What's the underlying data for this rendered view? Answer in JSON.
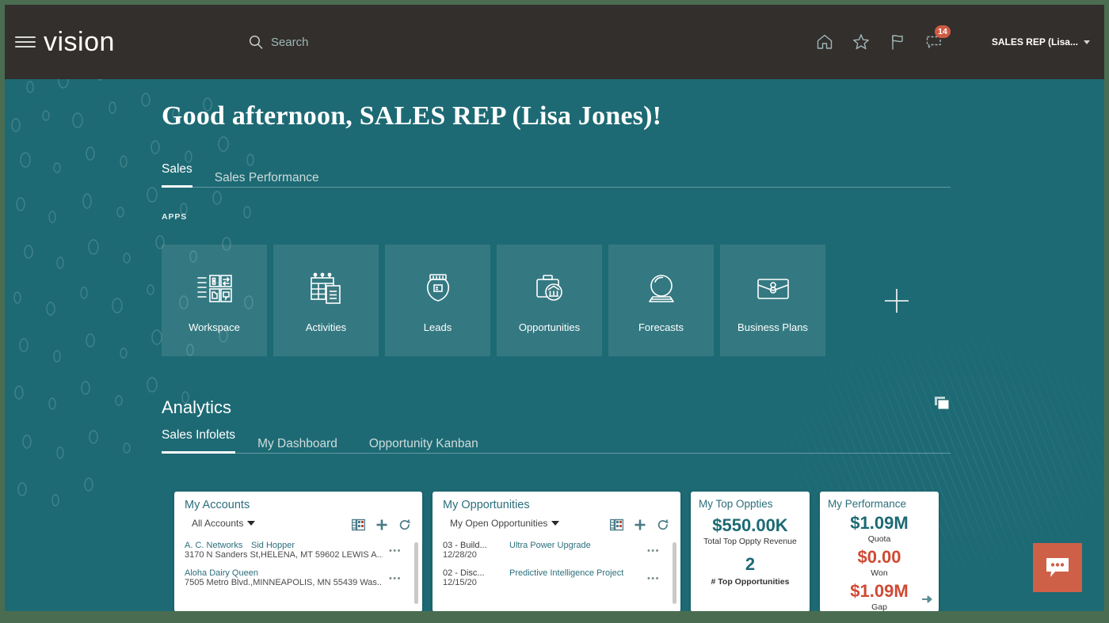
{
  "colors": {
    "outer_frame": "#4a6d51",
    "page_background": "#1d6a74",
    "topbar": "#332f2c",
    "accent_orange": "#cf6048",
    "badge_red": "#cf5b44",
    "card_title_teal": "#2b6e7b",
    "kpi_red": "#cf4a33"
  },
  "topbar": {
    "menu_icon": "hamburger-icon",
    "brand": "vision",
    "search": {
      "icon": "search-icon",
      "label": "Search",
      "placeholder": "Search"
    },
    "icons": [
      {
        "name": "home-icon",
        "label": "Home"
      },
      {
        "name": "star-icon",
        "label": "Favorites"
      },
      {
        "name": "flag-icon",
        "label": "Flags"
      },
      {
        "name": "notifications-icon",
        "label": "Notifications",
        "badge": "14"
      }
    ],
    "user": {
      "label": "SALES REP (Lisa...",
      "caret": "chevron-down-icon"
    }
  },
  "main": {
    "greeting": "Good afternoon, SALES REP (Lisa Jones)!",
    "tabs": [
      {
        "label": "Sales",
        "active": true
      },
      {
        "label": "Sales Performance",
        "active": false
      }
    ],
    "apps_label": "APPS",
    "apps": [
      {
        "label": "Workspace",
        "icon": "workspace-icon"
      },
      {
        "label": "Activities",
        "icon": "calendar-icon"
      },
      {
        "label": "Leads",
        "icon": "leads-icon"
      },
      {
        "label": "Opportunities",
        "icon": "briefcase-icon"
      },
      {
        "label": "Forecasts",
        "icon": "crystal-ball-icon"
      },
      {
        "label": "Business Plans",
        "icon": "portfolio-icon"
      }
    ],
    "add_app": {
      "icon": "plus-icon",
      "label": "Add App"
    }
  },
  "analytics": {
    "title": "Analytics",
    "expand_icon": "stacked-cards-icon",
    "tabs": [
      {
        "label": "Sales Infolets",
        "active": true
      },
      {
        "label": "My Dashboard",
        "active": false
      },
      {
        "label": "Opportunity Kanban",
        "active": false
      }
    ]
  },
  "cards": {
    "my_accounts": {
      "title": "My Accounts",
      "filter": "All Accounts",
      "actions": [
        {
          "name": "table-view-icon"
        },
        {
          "name": "plus-icon"
        },
        {
          "name": "refresh-icon"
        }
      ],
      "rows": [
        {
          "col1": "A. C. Networks",
          "col2": "Sid Hopper",
          "sub": "3170 N Sanders St,HELENA, MT 59602 LEWIS A...",
          "menu": "•••"
        },
        {
          "col1": "Aloha Dairy Queen",
          "col2": "",
          "sub": "7505 Metro Blvd.,MINNEAPOLIS, MN 55439 Was...",
          "menu": "•••"
        }
      ]
    },
    "my_opportunities": {
      "title": "My Opportunities",
      "filter": "My Open Opportunities",
      "actions": [
        {
          "name": "table-view-icon"
        },
        {
          "name": "plus-icon"
        },
        {
          "name": "refresh-icon"
        }
      ],
      "rows": [
        {
          "col1": "03 - Build...",
          "col2": "Ultra Power Upgrade",
          "sub": "12/28/20",
          "menu": "•••"
        },
        {
          "col1": "02 - Disc...",
          "col2": "Predictive Intelligence Project",
          "sub": "12/15/20",
          "menu": "•••"
        }
      ]
    },
    "my_top_oppties": {
      "title": "My Top Oppties",
      "value1": "$550.00K",
      "label1": "Total Top Oppty Revenue",
      "value2": "2",
      "label2": "# Top Opportunities"
    },
    "my_performance": {
      "title": "My Performance",
      "rows": [
        {
          "value": "$1.09M",
          "label": "Quota",
          "style": "teal"
        },
        {
          "value": "$0.00",
          "label": "Won",
          "style": "red"
        },
        {
          "value": "$1.09M",
          "label": "Gap",
          "style": "red"
        }
      ],
      "next_arrow": "arrow-right-icon"
    }
  },
  "chat": {
    "icon": "chat-bubble-icon",
    "label": "Chat"
  }
}
